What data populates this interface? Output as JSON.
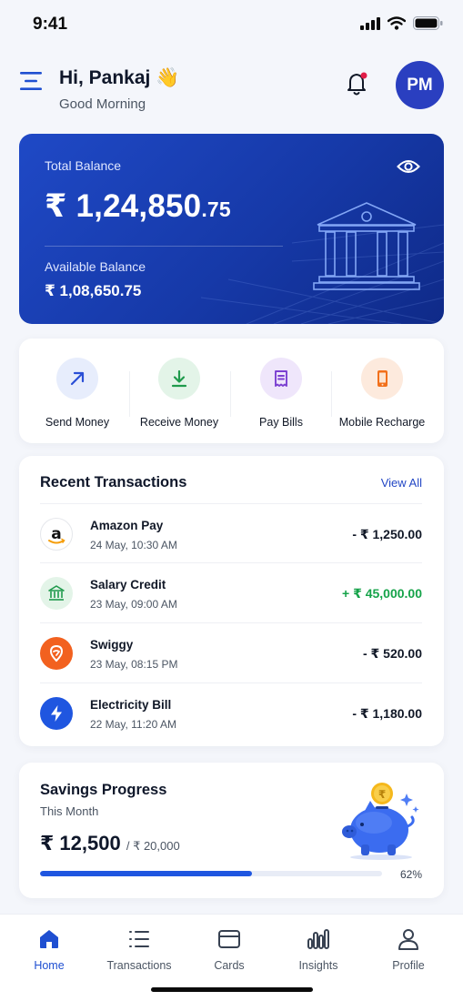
{
  "status_bar": {
    "time": "9:41"
  },
  "header": {
    "greeting": "Hi, Pankaj 👋",
    "subtitle": "Good Morning",
    "avatar_initials": "PM"
  },
  "balance": {
    "total_label": "Total Balance",
    "total_main": "₹ 1,24,850",
    "total_decimal": ".75",
    "available_label": "Available Balance",
    "available_amount": "₹ 1,08,650.75"
  },
  "quick_actions": [
    {
      "label": "Send Money",
      "icon": "arrow-up-right-icon",
      "color": "#2a4fd6"
    },
    {
      "label": "Receive Money",
      "icon": "download-icon",
      "color": "#1f9a4c"
    },
    {
      "label": "Pay Bills",
      "icon": "receipt-icon",
      "color": "#7b3fd1"
    },
    {
      "label": "Mobile Recharge",
      "icon": "mobile-icon",
      "color": "#f2701b"
    }
  ],
  "transactions": {
    "title": "Recent Transactions",
    "view_all": "View All",
    "items": [
      {
        "name": "Amazon Pay",
        "date": "24 May, 10:30 AM",
        "amount": "- ₹ 1,250.00",
        "type": "debit",
        "icon": "amazon-logo"
      },
      {
        "name": "Salary Credit",
        "date": "23 May, 09:00 AM",
        "amount": "+ ₹ 45,000.00",
        "type": "credit",
        "icon": "bank-icon"
      },
      {
        "name": "Swiggy",
        "date": "23 May, 08:15 PM",
        "amount": "- ₹ 520.00",
        "type": "debit",
        "icon": "swiggy-logo"
      },
      {
        "name": "Electricity Bill",
        "date": "22 May, 11:20 AM",
        "amount": "- ₹ 1,180.00",
        "type": "debit",
        "icon": "lightning-icon"
      }
    ]
  },
  "savings": {
    "title": "Savings Progress",
    "subtitle": "This Month",
    "amount": "₹ 12,500",
    "target": "/ ₹ 20,000",
    "progress_percent": 62,
    "progress_label": "62%"
  },
  "nav": [
    {
      "label": "Home",
      "icon": "home-icon",
      "active": true
    },
    {
      "label": "Transactions",
      "icon": "list-icon",
      "active": false
    },
    {
      "label": "Cards",
      "icon": "card-icon",
      "active": false
    },
    {
      "label": "Insights",
      "icon": "insights-icon",
      "active": false
    },
    {
      "label": "Profile",
      "icon": "profile-icon",
      "active": false
    }
  ],
  "colors": {
    "primary": "#1f4fd1",
    "credit": "#16a34a",
    "background": "#f4f6fb"
  }
}
